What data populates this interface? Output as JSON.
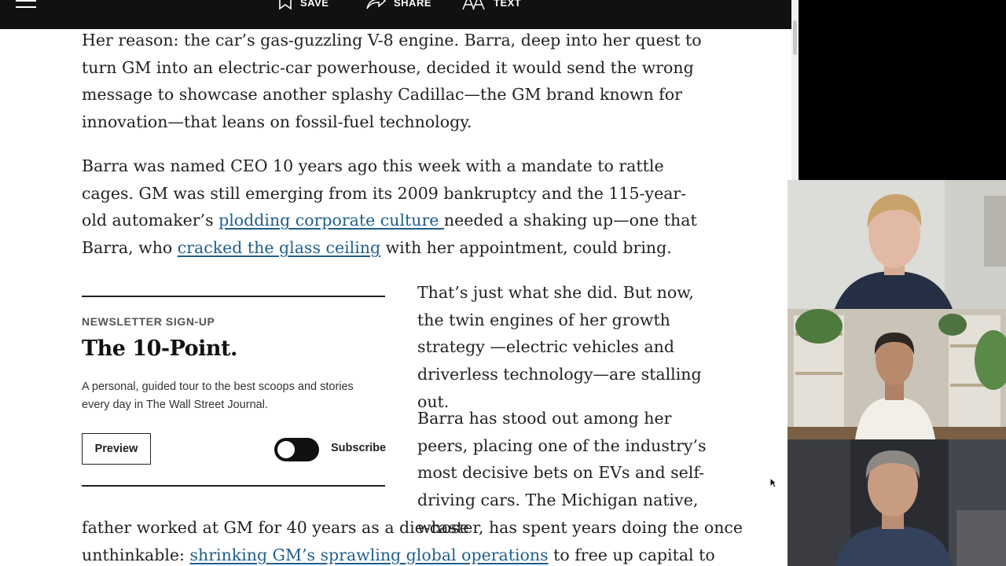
{
  "toolbar": {
    "save_label": "SAVE",
    "share_label": "SHARE",
    "text_label": "TEXT"
  },
  "article": {
    "para1": {
      "text": "Her reason: the car’s gas-guzzling V-8 engine. Barra, deep into her quest to turn GM into an electric-car powerhouse, decided it would send the wrong message to showcase another splashy Cadillac—the GM brand known for innovation—that leans on fossil-fuel technology."
    },
    "para2": {
      "before": "Barra was named CEO 10 years ago this week with a mandate to rattle cages. GM was still emerging from its 2009 bankruptcy and the 115-year-old automaker’s ",
      "link1": "plodding corporate culture ",
      "middle": "needed a shaking up—one that Barra, who ",
      "link2": "cracked the glass ceiling",
      "after": " with her appointment, could bring."
    },
    "para3": {
      "text": "That’s just what she did. But now, the twin engines of her growth strategy —electric vehicles and driverless technology—are stalling out."
    },
    "para4": {
      "text": "Barra has stood out among her peers, placing one of the industry’s most decisive bets on EVs and self-driving cars. The Michigan native, whose"
    },
    "para5": {
      "line1": "father worked at GM for 40 years as a die-caster, has spent years doing the once",
      "line2_before": "unthinkable: ",
      "link": "shrinking GM’s sprawling global operations",
      "line2_after": " to free up capital to"
    }
  },
  "newsletter": {
    "kicker": "NEWSLETTER SIGN-UP",
    "title": "The 10-Point.",
    "description": "A personal, guided tour to the best scoops and stories every day in The Wall Street Journal.",
    "preview_label": "Preview",
    "subscribe_label": "Subscribe",
    "subscribed": false
  },
  "video_call": {
    "participants": [
      {
        "name": "participant-1"
      },
      {
        "name": "participant-2"
      },
      {
        "name": "participant-3"
      }
    ]
  },
  "colors": {
    "link": "#1f5f8b",
    "toolbar_bg": "#111111",
    "text": "#222222"
  },
  "icons": {
    "menu": "hamburger-icon",
    "save": "bookmark-icon",
    "share": "share-arrow-icon",
    "text": "text-size-icon"
  }
}
